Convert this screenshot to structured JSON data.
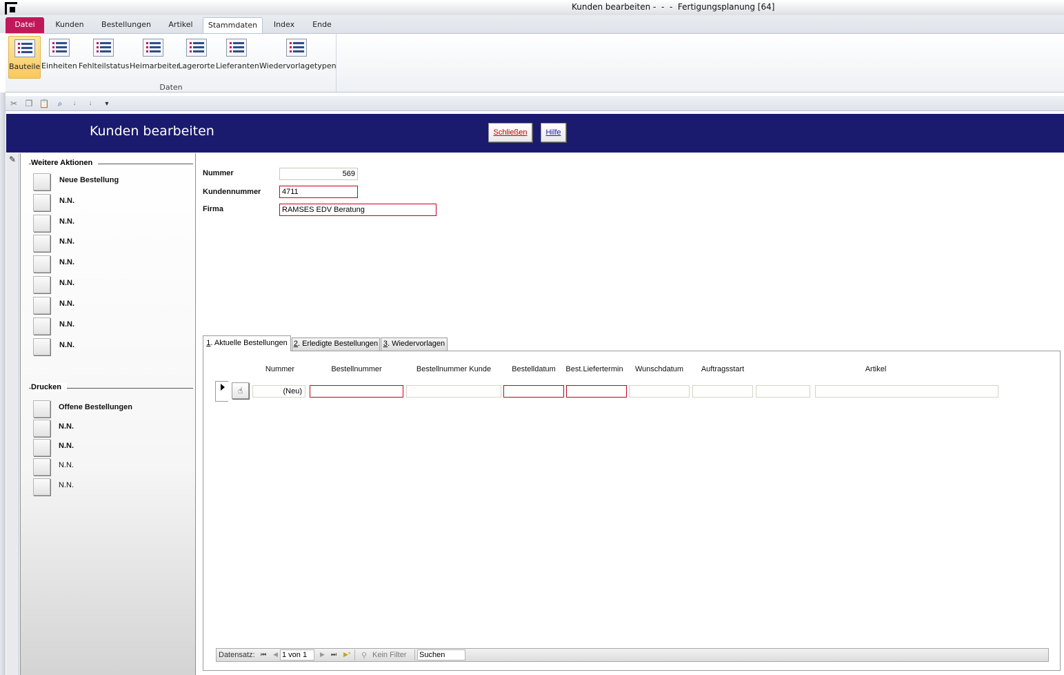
{
  "window": {
    "title": "Kunden bearbeiten -  -  -  Fertigungsplanung [64]"
  },
  "ribbon": {
    "tabs": [
      {
        "label": "Datei"
      },
      {
        "label": "Kunden"
      },
      {
        "label": "Bestellungen"
      },
      {
        "label": "Artikel"
      },
      {
        "label": "Stammdaten"
      },
      {
        "label": "Index"
      },
      {
        "label": "Ende"
      }
    ],
    "active_tab": "Stammdaten",
    "group_label": "Daten",
    "buttons": [
      {
        "label": "Bauteile"
      },
      {
        "label": "Einheiten"
      },
      {
        "label": "Fehlteilstatus"
      },
      {
        "label": "Heimarbeiter"
      },
      {
        "label": "Lagerorte"
      },
      {
        "label": "Lieferanten"
      },
      {
        "label": "Wiedervorlagetypen"
      }
    ],
    "selected_button": "Bauteile"
  },
  "qat": {
    "icons": [
      "cut-icon",
      "copy-icon",
      "paste-icon",
      "find-icon",
      "sort-ascending-icon",
      "sort-descending-icon",
      "customize-dropdown-icon"
    ]
  },
  "header": {
    "title": "Kunden bearbeiten",
    "close_label": "Schließen",
    "help_label": "Hilfe",
    "bg_color": "#1a1a6e"
  },
  "left_panel": {
    "actions_title": "Weitere Aktionen",
    "actions": [
      {
        "label": "Neue Bestellung"
      },
      {
        "label": "N.N."
      },
      {
        "label": "N.N."
      },
      {
        "label": "N.N."
      },
      {
        "label": "N.N."
      },
      {
        "label": "N.N."
      },
      {
        "label": "N.N."
      },
      {
        "label": "N.N."
      },
      {
        "label": "N.N."
      }
    ],
    "print_title": "Drucken",
    "print_actions": [
      {
        "label": "Offene Bestellungen"
      },
      {
        "label": "N.N."
      },
      {
        "label": "N.N."
      },
      {
        "label": "N.N."
      },
      {
        "label": "N.N."
      }
    ]
  },
  "form": {
    "nummer_label": "Nummer",
    "nummer_value": "569",
    "kundennummer_label": "Kundennummer",
    "kundennummer_value": "4711",
    "firma_label": "Firma",
    "firma_value": "RAMSES EDV Beratung"
  },
  "tabs": [
    {
      "key": "1",
      "label": ". Aktuelle Bestellungen"
    },
    {
      "key": "2",
      "label": ". Erledigte Bestellungen"
    },
    {
      "key": "3",
      "label": ". Wiedervorlagen"
    }
  ],
  "subform": {
    "columns": [
      "Nummer",
      "Bestellnummer",
      "Bestellnummer Kunde",
      "Bestelldatum",
      "Best.Liefertermin",
      "Wunschdatum",
      "Auftragsstart",
      "Artikel"
    ],
    "new_row_value": "(Neu)"
  },
  "nav_bar": {
    "record_label": "Datensatz:",
    "record_value": "1 von 1",
    "filter_label": "Kein Filter",
    "search_label": "Suchen"
  },
  "colors": {
    "file_tab": "#c0185b",
    "required_border": "#c00020"
  }
}
